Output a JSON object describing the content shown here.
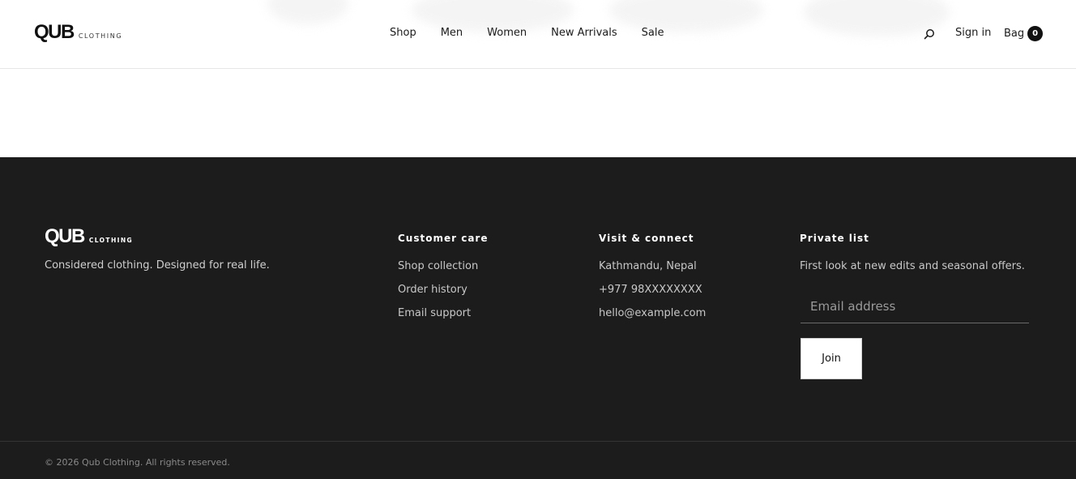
{
  "header": {
    "logo_mark": "QUB",
    "logo_sub": "CLOTHING",
    "nav": [
      "Shop",
      "Men",
      "Women",
      "New Arrivals",
      "Sale"
    ],
    "search_icon": "search-icon",
    "signin": "Sign in",
    "bag_label": "Bag",
    "bag_count": "0"
  },
  "footer": {
    "logo_mark": "QUB",
    "logo_sub": "CLOTHING",
    "tagline": "Considered clothing. Designed for real life.",
    "care": {
      "title": "Customer care",
      "links": [
        "Shop collection",
        "Order history",
        "Email support"
      ]
    },
    "connect": {
      "title": "Visit & connect",
      "items": [
        "Kathmandu, Nepal",
        "+977 98XXXXXXXX",
        "hello@example.com"
      ]
    },
    "private": {
      "title": "Private list",
      "text": "First look at new edits and seasonal offers.",
      "email_placeholder": "Email address",
      "email_value": "",
      "join": "Join"
    },
    "copyright": "© 2026 Qub Clothing. All rights reserved."
  },
  "colors": {
    "footer_bg": "#1c1c1c",
    "text_dark": "#1b1b1b",
    "badge_bg": "#111111"
  }
}
